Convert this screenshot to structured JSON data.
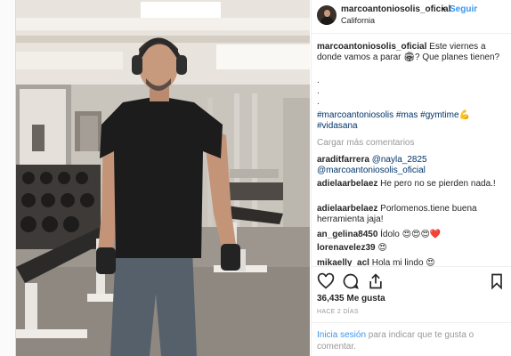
{
  "post": {
    "photo_icon": "gym-photo",
    "header": {
      "username": "marcoantoniosolis_oficial",
      "separator": "•",
      "follow_label": "Seguir",
      "location": "California"
    },
    "caption": {
      "username": "marcoantoniosolis_oficial",
      "line1": "Este viernes a donde vamos a parar",
      "emoji": "🏟",
      "line2": "? Que planes tienen?",
      "dots": [
        ".",
        ".",
        "."
      ],
      "hashtags1": "#marcoantoniosolis #mas #gymtime",
      "emoji2": "💪",
      "hashtags2": "#vidasana"
    },
    "load_more": "Cargar más comentarios",
    "comments": [
      {
        "user": "araditfarrera",
        "mention": "@nayla_2825",
        "mention2": "@marcoantoniosolis_oficial",
        "text": ""
      },
      {
        "user": "adielaarbelaez",
        "text": "He pero no se pierden nada.!"
      },
      {
        "user": "adielaarbelaez",
        "text": "Porlomenos.tiene buena herramienta jaja!"
      },
      {
        "user": "an_gelina8450",
        "text": "Ídolo 😍😍😍❤️"
      },
      {
        "user": "lorenavelez39",
        "text": "😍"
      },
      {
        "user": "mikaelly_acl",
        "text": "Hola mi lindo 😍"
      }
    ],
    "likes": "36,435 Me gusta",
    "time": "HACE 2 DÍAS",
    "login": {
      "link": "Inicia sesión",
      "text": " para indicar que te gusta o comentar."
    },
    "icons": {
      "like": "heart-icon",
      "comment": "comment-icon",
      "share": "share-icon",
      "save": "bookmark-icon"
    }
  }
}
